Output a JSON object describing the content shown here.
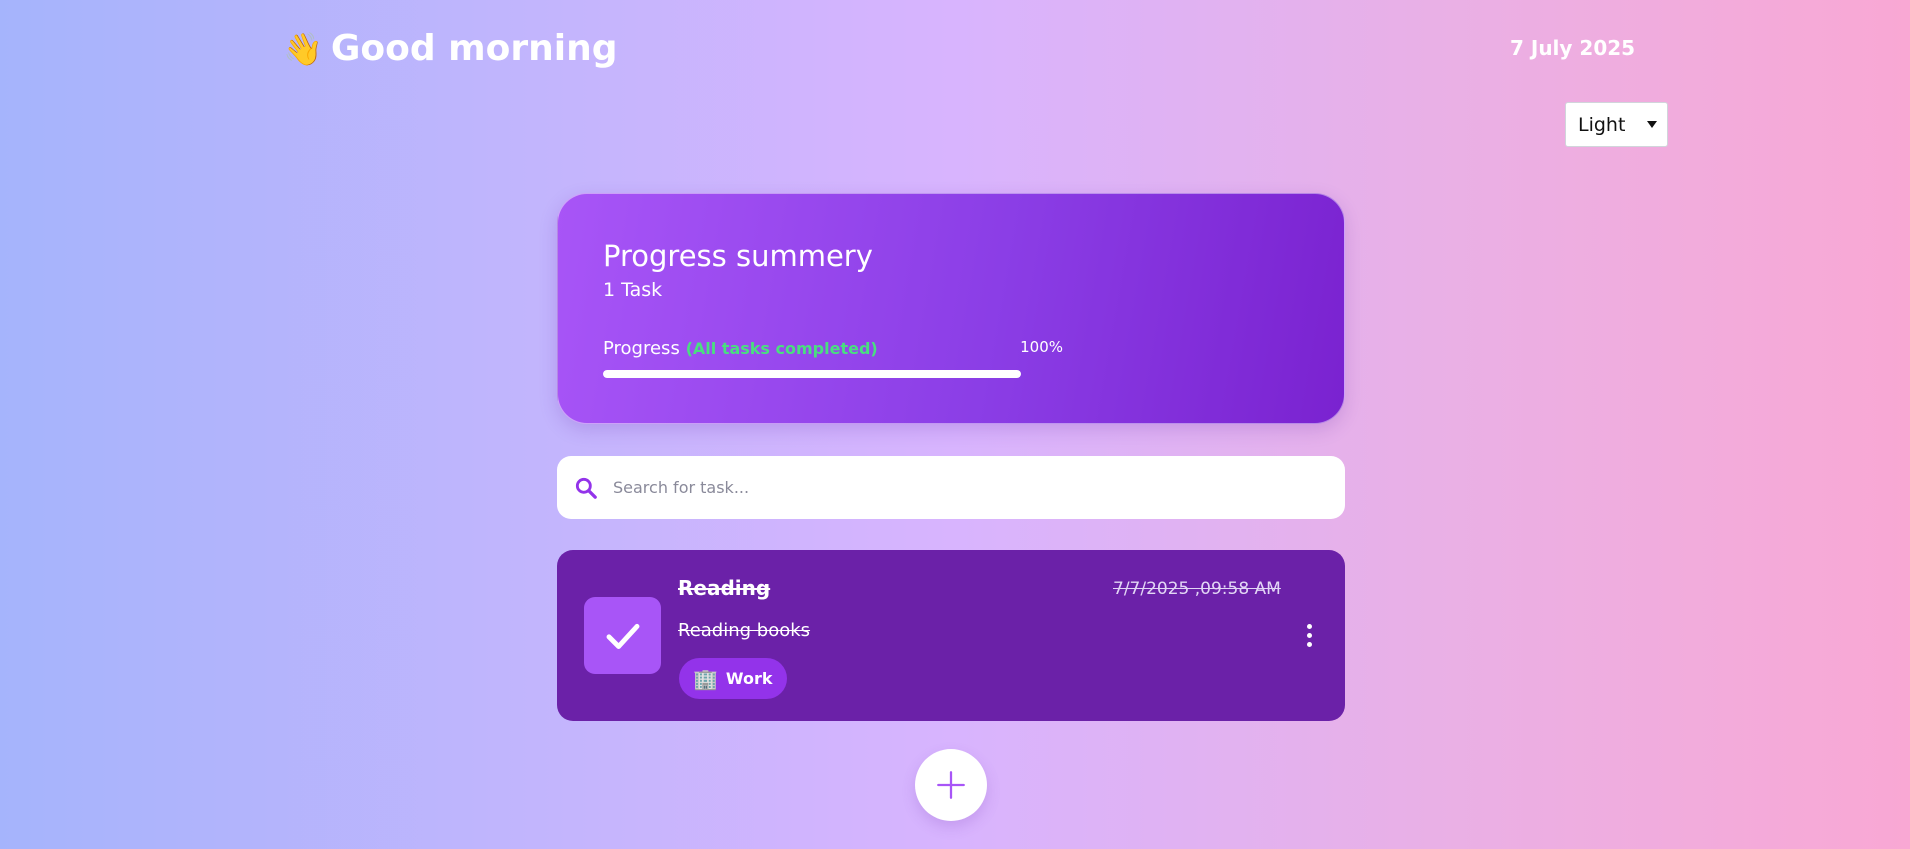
{
  "header": {
    "wave_icon": "👋",
    "greeting": "Good morning",
    "date": "7 July 2025"
  },
  "theme_select": {
    "value": "Light",
    "icon": "chevron-down-icon"
  },
  "summary": {
    "title": "Progress summery",
    "task_count": "1 Task",
    "progress_label": "Progress",
    "progress_status": "(All tasks completed)",
    "progress_percent_text": "100%",
    "progress_value": 1.0
  },
  "search": {
    "placeholder": "Search for task...",
    "value": "",
    "icon": "search-icon"
  },
  "tasks": [
    {
      "title": "Reading",
      "date": "7/7/2025 ,09:58 AM",
      "description": "Reading books",
      "completed": true,
      "category": {
        "emoji": "🏢",
        "label": "Work"
      }
    }
  ],
  "add_button": {
    "icon": "plus-icon"
  },
  "colors": {
    "accent": "#a855f7",
    "task_card_bg": "#6b21a8",
    "category_bg": "#9333ea",
    "status_green": "#4ade80",
    "search_icon": "#9333ea"
  }
}
